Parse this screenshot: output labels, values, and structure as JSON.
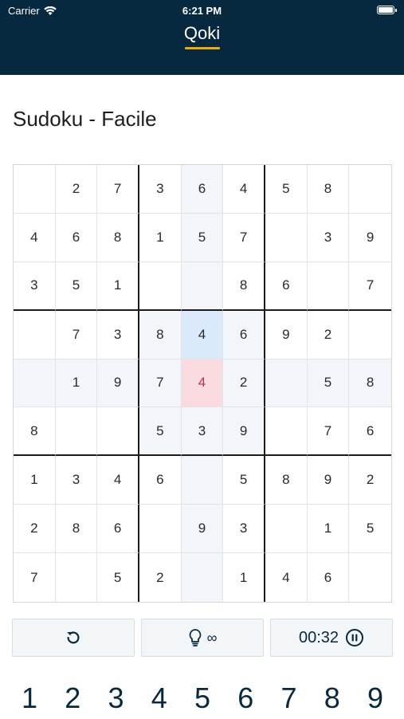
{
  "status_bar": {
    "carrier": "Carrier",
    "time": "6:21 PM"
  },
  "header": {
    "app_title": "Qoki",
    "accent_color": "#f2a900",
    "background_color": "#06293f"
  },
  "page": {
    "title": "Sudoku - Facile"
  },
  "board": {
    "rows": [
      [
        "",
        "2",
        "7",
        "3",
        "6",
        "4",
        "5",
        "8",
        ""
      ],
      [
        "4",
        "6",
        "8",
        "1",
        "5",
        "7",
        "",
        "3",
        "9"
      ],
      [
        "3",
        "5",
        "1",
        "",
        "",
        "8",
        "6",
        "",
        "7"
      ],
      [
        "",
        "7",
        "3",
        "8",
        "4",
        "6",
        "9",
        "2",
        ""
      ],
      [
        "",
        "1",
        "9",
        "7",
        "4",
        "2",
        "",
        "5",
        "8"
      ],
      [
        "8",
        "",
        "",
        "5",
        "3",
        "9",
        "",
        "7",
        "6"
      ],
      [
        "1",
        "3",
        "4",
        "6",
        "",
        "5",
        "8",
        "9",
        "2"
      ],
      [
        "2",
        "8",
        "6",
        "",
        "9",
        "3",
        "",
        "1",
        "5"
      ],
      [
        "7",
        "",
        "5",
        "2",
        "",
        "1",
        "4",
        "6",
        ""
      ]
    ],
    "selected_cell": {
      "row": 4,
      "col": 4
    },
    "same_value_cell": {
      "row": 3,
      "col": 4
    },
    "highlight_color": "#f2f6fa",
    "selected_color": "#f9dbe0",
    "same_value_color": "#dbeafb"
  },
  "controls": {
    "undo_icon": "undo-icon",
    "hint_icon": "lightbulb-icon",
    "hint_count": "∞",
    "timer": "00:32",
    "pause_icon": "pause-circle-icon"
  },
  "numpad": [
    "1",
    "2",
    "3",
    "4",
    "5",
    "6",
    "7",
    "8",
    "9"
  ]
}
